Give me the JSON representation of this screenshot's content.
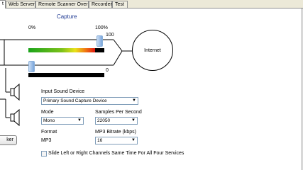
{
  "tabs": [
    {
      "label": "t",
      "active": true
    },
    {
      "label": "Web Server",
      "active": false
    },
    {
      "label": "Remote Scanner Over IP",
      "active": false
    },
    {
      "label": "Recorder",
      "active": false
    },
    {
      "label": "Test",
      "active": false
    }
  ],
  "capture": {
    "title": "Capture",
    "scale_min_label": "0%",
    "scale_max_label": "100%",
    "level_top_label": "100",
    "level_bottom_label": "0",
    "meter_fill_fraction": 0.88
  },
  "internet_label": "Internet",
  "input_sound_device": {
    "label": "Input Sound Device",
    "value": "Primary Sound Capture Device"
  },
  "mode": {
    "label": "Mode",
    "value": "Mono"
  },
  "samples_per_second": {
    "label": "Samples Per Second",
    "value": "22050"
  },
  "format": {
    "label": "Format",
    "value": "MP3"
  },
  "mp3_bitrate": {
    "label": "MP3 Bitrate (kbps)",
    "value": "16"
  },
  "slide_checkbox": {
    "label": "Slide Left or Right Channels Same Time For All Four Services",
    "checked": false
  },
  "speaker_button": {
    "label": "ker"
  },
  "icons": {
    "dropdown": "chevron-down-icon",
    "speaker": "speaker-icon"
  }
}
